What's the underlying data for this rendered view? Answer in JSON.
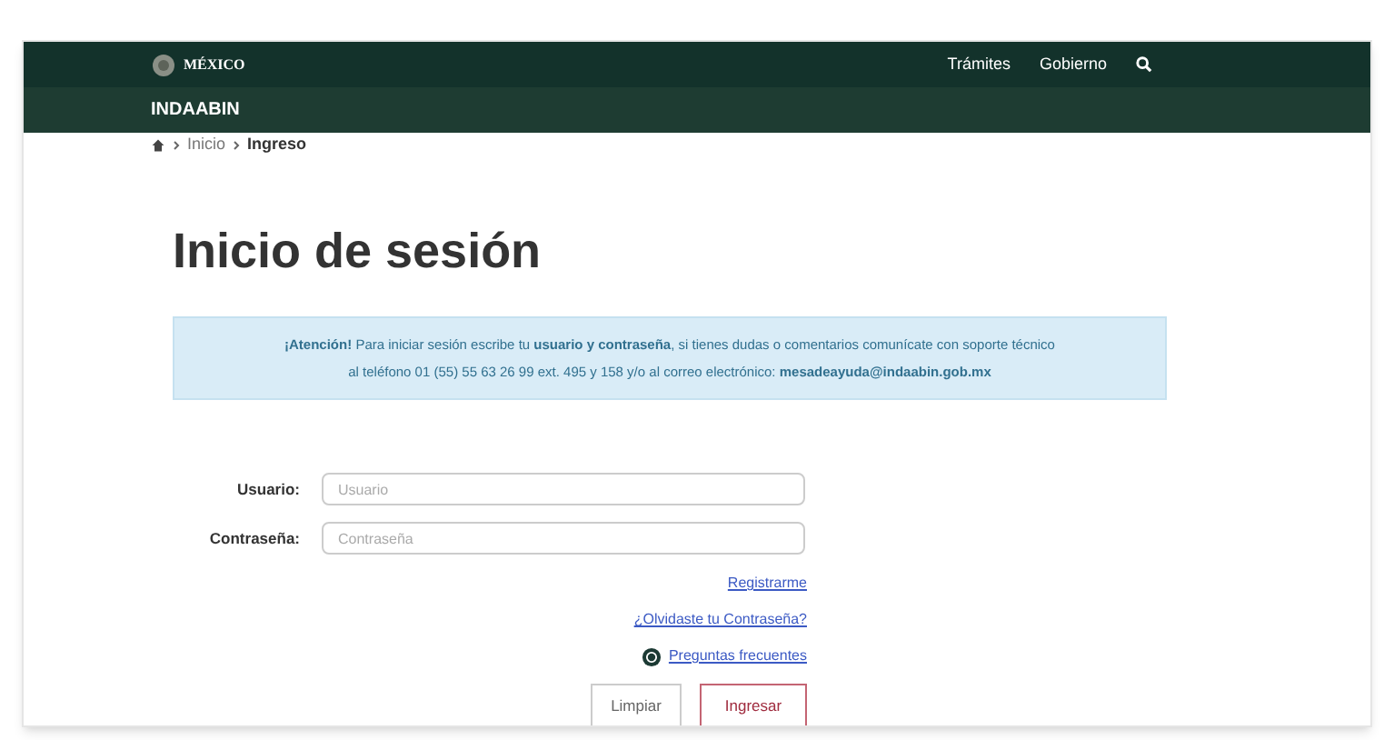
{
  "header": {
    "logo_text": "MÉXICO",
    "nav": [
      "Trámites",
      "Gobierno"
    ]
  },
  "subheader": {
    "title": "INDAABIN"
  },
  "breadcrumb": [
    {
      "label": "Inicio",
      "current": false
    },
    {
      "label": "Ingreso",
      "current": true
    }
  ],
  "page_title": "Inicio de sesión",
  "alert": {
    "line1": "**¡Atención!** Para iniciar sesión escribe tu **usuario y contraseña**, si tienes dudas o comentarios comunícate con soporte técnico",
    "line2": "al teléfono 01 (55) 55 63 26 99 ext. 495 y 158 y/o al correo electrónico: **mesadeayuda@indaabin.gob.mx**"
  },
  "form": {
    "fields": [
      {
        "label": "Usuario:",
        "placeholder": "Usuario"
      },
      {
        "label": "Contraseña:",
        "placeholder": "Contraseña"
      }
    ],
    "links": [
      {
        "label": "Registrarme",
        "kind": "plain"
      },
      {
        "label": "¿Olvidaste tu Contraseña?",
        "kind": "plain"
      },
      {
        "label": "Preguntas frecuentes",
        "kind": "icon"
      }
    ],
    "buttons": [
      {
        "label": "Limpiar",
        "kind": "secondary"
      },
      {
        "label": "Ingresar",
        "kind": "primary"
      }
    ]
  }
}
